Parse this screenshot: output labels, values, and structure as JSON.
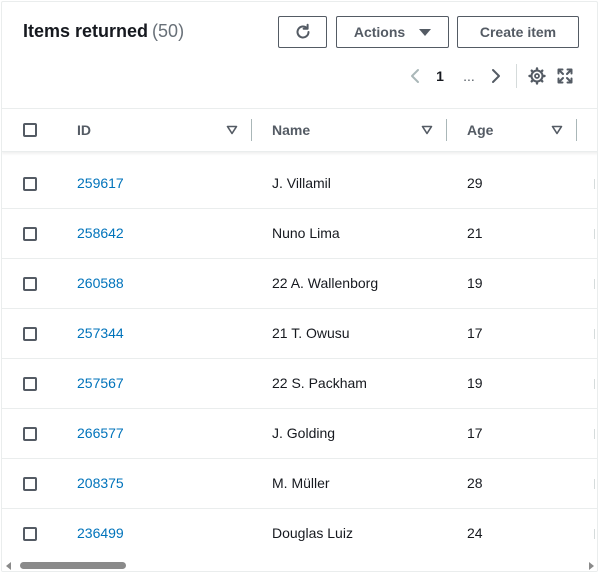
{
  "header": {
    "title": "Items returned",
    "count": "(50)"
  },
  "toolbar": {
    "refresh_icon": "refresh-icon",
    "actions_label": "Actions",
    "create_label": "Create item"
  },
  "pagination": {
    "current_page": "1",
    "ellipsis": "...",
    "prev_icon": "chevron-left-icon",
    "next_icon": "chevron-right-icon",
    "settings_icon": "gear-icon",
    "fullscreen_icon": "expand-icon"
  },
  "table": {
    "columns": [
      "ID",
      "Name",
      "Age"
    ],
    "rows": [
      {
        "id": "259617",
        "name": "J. Villamil",
        "age": "29"
      },
      {
        "id": "258642",
        "name": "Nuno Lima",
        "age": "21"
      },
      {
        "id": "260588",
        "name": "22 A. Wallenborg",
        "age": "19"
      },
      {
        "id": "257344",
        "name": "21 T. Owusu",
        "age": "17"
      },
      {
        "id": "257567",
        "name": "22 S. Packham",
        "age": "19"
      },
      {
        "id": "266577",
        "name": "J. Golding",
        "age": "17"
      },
      {
        "id": "208375",
        "name": "M. Müller",
        "age": "28"
      },
      {
        "id": "236499",
        "name": "Douglas Luiz",
        "age": "24"
      }
    ]
  },
  "colors": {
    "link": "#0073bb",
    "text": "#16191f",
    "muted": "#687078",
    "border": "#545b64"
  }
}
